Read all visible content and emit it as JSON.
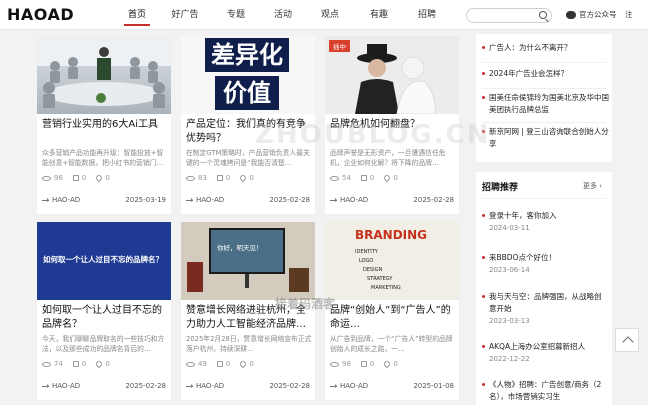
{
  "header": {
    "logo": "HAOAD",
    "nav": [
      "首页",
      "好广告",
      "专题",
      "活动",
      "观点",
      "有趣",
      "招聘"
    ],
    "search_placeholder": "",
    "wechat": "官方公众号",
    "register": "注"
  },
  "cards": [
    {
      "title": "营销行业实用的6大Ai工具",
      "desc": "众多营销产品功能再升级：智能投放+智能创意+智能数据，把小红书的营销门…",
      "views": "96",
      "likes": "0",
      "favs": "0",
      "author": "HAO-AD",
      "date": "2025-03-19",
      "badge": ""
    },
    {
      "title": "产品定位：我们真的有竞争优势吗？",
      "desc": "在制定GTM策略时，产品营销负责人最关键的一个灵魂拷问是“我能否清楚…",
      "views": "83",
      "likes": "0",
      "favs": "0",
      "author": "HAO-AD",
      "date": "2025-02-28",
      "badge": ""
    },
    {
      "title": "品牌危机如何翻盘？",
      "desc": "品牌声誉是无形资产，一旦遭遇信任危机，企业如何化解？将下降的品牌…",
      "views": "54",
      "likes": "0",
      "favs": "0",
      "author": "HAO-AD",
      "date": "2025-02-28",
      "badge": "插中"
    },
    {
      "title": "如何取一个让人过目不忘的品牌名？",
      "desc": "今天，我们聊聊品牌取名的一些技巧和方法，以及那些成功的品牌名背后的…",
      "views": "74",
      "likes": "0",
      "favs": "0",
      "author": "HAO-AD",
      "date": "2025-02-28",
      "badge": ""
    },
    {
      "title": "赞意增长网络进驻杭州，全力助力人工智能经济品牌…",
      "desc": "2025年2月28日，赞意增长网络宣布正式落户杭州，持续深耕…",
      "views": "49",
      "likes": "0",
      "favs": "0",
      "author": "HAO-AD",
      "date": "2025-02-28",
      "badge": ""
    },
    {
      "title": "品牌“创始人”到“广告人”的命运…",
      "desc": "从广告到品牌，一个“广告人”转型的品牌创始人的成长之路，一…",
      "views": "98",
      "likes": "0",
      "favs": "0",
      "author": "HAO-AD",
      "date": "2025-01-08",
      "badge": ""
    }
  ],
  "thumbs": {
    "card2_line1": "差异化",
    "card2_line2": "价值",
    "card4_text": "如何取一个让人过目不忘的品牌名？",
    "card5_screen": "你好，明天见！",
    "card6_brand": "BRANDING",
    "card6_items": [
      "IDENTITY",
      "LOGO",
      "DESIGN",
      "STRATEGY",
      "MARKETING"
    ]
  },
  "sidebar": {
    "top_items": [
      "广告人：为什么不离开？",
      "2024年广告业会怎样？",
      "国美任命侯锦玲为国美北京及华中国美团执行品牌总监",
      "新京阿网 | 登三山咨询联合创始人分享"
    ],
    "recommend_title": "招聘推荐",
    "more": "更多",
    "recommend": [
      {
        "title": "登录十年，客你加入",
        "date": "2024-03-11"
      },
      {
        "title": "来BBDO点个好位！",
        "date": "2023-06-14"
      },
      {
        "title": "我与天与空：品牌强国，从战略创意开始",
        "date": "2023-03-13"
      },
      {
        "title": "AKQA上海办公室招募新招人",
        "date": "2022-12-22"
      },
      {
        "title": "《人物》招聘：广告创意/商务（2名），市场营销实习生",
        "date": ""
      }
    ]
  },
  "watermark": {
    "main": "ZHOUBLOG.CN",
    "sub": "接着码酒客"
  }
}
